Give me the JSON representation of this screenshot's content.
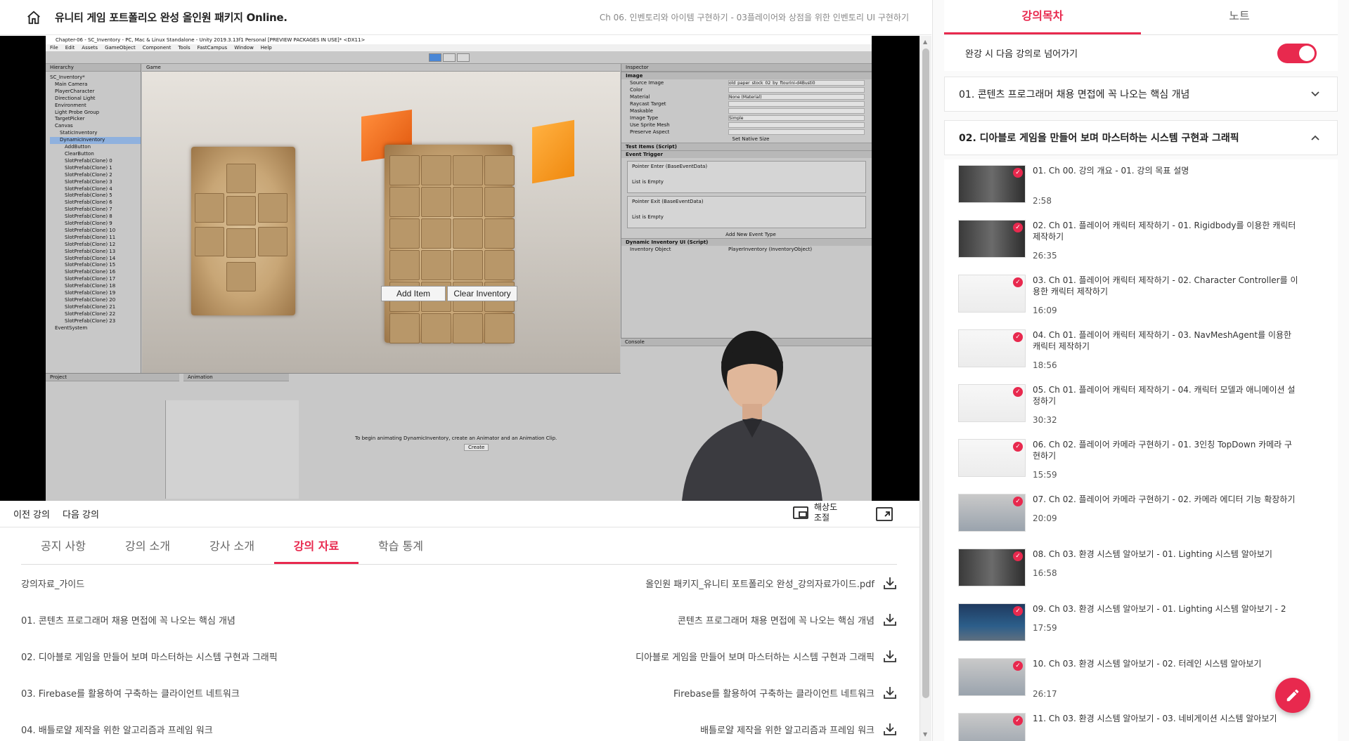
{
  "header": {
    "title": "유니티 게임 포트폴리오 완성 올인원 패키지 Online.",
    "chapter": "Ch 06. 인벤토리와 아이템 구현하기 - 03플레이어와 상점을 위한 인벤토리 UI 구현하기"
  },
  "video": {
    "window_title": "Chapter-06 - SC_Inventory - PC, Mac & Linux Standalone - Unity 2019.3.13f1 Personal [PREVIEW PACKAGES IN USE]* <DX11>",
    "menu": [
      "File",
      "Edit",
      "Assets",
      "GameObject",
      "Component",
      "Tools",
      "FastCampus",
      "Window",
      "Help"
    ],
    "hierarchy_tab": "Hierarchy",
    "hierarchy_items": [
      "SC_Inventory*",
      "Main Camera",
      "PlayerCharacter",
      "Directional Light",
      "Environment",
      "Light Probe Group",
      "TargetPicker",
      "Canvas",
      "StaticInventory",
      "DynamicInventory",
      "AddButton",
      "ClearButton",
      "SlotPrefab(Clone) 0",
      "SlotPrefab(Clone) 1",
      "SlotPrefab(Clone) 2",
      "SlotPrefab(Clone) 3",
      "SlotPrefab(Clone) 4",
      "SlotPrefab(Clone) 5",
      "SlotPrefab(Clone) 6",
      "SlotPrefab(Clone) 7",
      "SlotPrefab(Clone) 8",
      "SlotPrefab(Clone) 9",
      "SlotPrefab(Clone) 10",
      "SlotPrefab(Clone) 11",
      "SlotPrefab(Clone) 12",
      "SlotPrefab(Clone) 13",
      "SlotPrefab(Clone) 14",
      "SlotPrefab(Clone) 15",
      "SlotPrefab(Clone) 16",
      "SlotPrefab(Clone) 17",
      "SlotPrefab(Clone) 18",
      "SlotPrefab(Clone) 19",
      "SlotPrefab(Clone) 20",
      "SlotPrefab(Clone) 21",
      "SlotPrefab(Clone) 22",
      "SlotPrefab(Clone) 23",
      "EventSystem"
    ],
    "game_tab": "Game",
    "game_buttons": {
      "add_item": "Add Item",
      "clear_inventory": "Clear Inventory"
    },
    "inspector_tab": "Inspector",
    "inspector_fields": [
      {
        "k": "Source Image",
        "v": "old_paper_stock_02_by_ftourini-d4Busti0"
      },
      {
        "k": "Color",
        "v": ""
      },
      {
        "k": "Material",
        "v": "None (Material)"
      },
      {
        "k": "Raycast Target",
        "v": ""
      },
      {
        "k": "Maskable",
        "v": ""
      },
      {
        "k": "Image Type",
        "v": "Simple"
      },
      {
        "k": "Use Sprite Mesh",
        "v": ""
      },
      {
        "k": "Preserve Aspect",
        "v": ""
      }
    ],
    "inspector_image_header": "Image",
    "set_native_size": "Set Native Size",
    "test_items_script": "Test Items (Script)",
    "event_trigger": "Event Trigger",
    "pointer_enter": "Pointer Enter (BaseEventData)",
    "pointer_exit": "Pointer Exit (BaseEventData)",
    "list_empty": "List is Empty",
    "add_event": "Add New Event Type",
    "dyn_inv_script": "Dynamic Inventory UI (Script)",
    "inventory_object_label": "Inventory Object",
    "inventory_object_value": "PlayerInventory (InventoryObject)",
    "project_tab": "Project",
    "animation_tab": "Animation",
    "animation_hint": "To begin animating DynamicInventory, create an Animator and an Animation Clip.",
    "create_label": "Create",
    "console_tab": "Console"
  },
  "controls": {
    "prev": "이전 강의",
    "next": "다음 강의",
    "resolution": "해상도 조절"
  },
  "tabs": [
    "공지 사항",
    "강의 소개",
    "강사 소개",
    "강의 자료",
    "학습 통계"
  ],
  "active_tab": "강의 자료",
  "materials": [
    {
      "title": "강의자료_가이드",
      "file": "올인원 패키지_유니티 포트폴리오 완성_강의자료가이드.pdf"
    },
    {
      "title": "01. 콘텐츠 프로그래머 채용 면접에 꼭 나오는 핵심 개념",
      "file": "콘텐츠 프로그래머 채용 면접에 꼭 나오는 핵심 개념"
    },
    {
      "title": "02. 디아블로 게임을 만들어 보며 마스터하는 시스템 구현과 그래픽",
      "file": "디아블로 게임을 만들어 보며 마스터하는 시스템 구현과 그래픽"
    },
    {
      "title": "03. Firebase를 활용하여 구축하는 클라이언트 네트워크",
      "file": "Firebase를 활용하여 구축하는 클라이언트 네트워크"
    },
    {
      "title": "04. 배틀로얄 제작을 위한 알고리즘과 프레임 워크",
      "file": "배틀로얄 제작을 위한 알고리즘과 프레임 워크"
    }
  ],
  "side": {
    "tabs": [
      "강의목차",
      "노트"
    ],
    "autoplay": "완강 시 다음 강의로 넘어가기",
    "autoplay_on": true,
    "sections": [
      {
        "title": "01. 콘텐츠 프로그래머 채용 면접에 꼭 나오는 핵심 개념",
        "open": false
      },
      {
        "title": "02. 디아블로 게임을 만들어 보며 마스터하는 시스템 구현과 그래픽",
        "open": true
      }
    ],
    "lectures": [
      {
        "title": "01. Ch 00. 강의 개요 - 01. 강의 목표 설명",
        "duration": "2:58",
        "thumb": "dark"
      },
      {
        "title": "02. Ch 01. 플레이어 캐릭터 제작하기 - 01. Rigidbody를 이용한 캐릭터 제작하기",
        "duration": "26:35",
        "thumb": "dark"
      },
      {
        "title": "03. Ch 01. 플레이어 캐릭터 제작하기 - 02. Character Controller를 이용한 캐릭터 제작하기",
        "duration": "16:09",
        "thumb": "light"
      },
      {
        "title": "04. Ch 01. 플레이어 캐릭터 제작하기 - 03. NavMeshAgent를 이용한 캐릭터 제작하기",
        "duration": "18:56",
        "thumb": "light"
      },
      {
        "title": "05. Ch 01. 플레이어 캐릭터 제작하기 - 04. 캐릭터 모델과 애니메이션 설정하기",
        "duration": "30:32",
        "thumb": "light"
      },
      {
        "title": "06. Ch 02. 플레이어 카메라 구현하기 - 01. 3인칭 TopDown 카메라 구현하기",
        "duration": "15:59",
        "thumb": "light"
      },
      {
        "title": "07. Ch 02. 플레이어 카메라 구현하기 - 02. 카메라 에디터 기능 확장하기",
        "duration": "20:09",
        "thumb": "editor"
      },
      {
        "title": "08. Ch 03. 환경 시스템 알아보기 - 01. Lighting 시스템 알아보기",
        "duration": "16:58",
        "thumb": "dark"
      },
      {
        "title": "09. Ch 03. 환경 시스템 알아보기 - 01. Lighting 시스템 알아보기 - 2",
        "duration": "17:59",
        "thumb": "probes"
      },
      {
        "title": "10. Ch 03. 환경 시스템 알아보기 - 02. 터레인 시스템 알아보기",
        "duration": "26:17",
        "thumb": "editor"
      },
      {
        "title": "11. Ch 03. 환경 시스템 알아보기 - 03. 네비게이션 시스템 알아보기",
        "duration": "",
        "thumb": "editor"
      }
    ]
  },
  "colors": {
    "accent": "#e8294e"
  }
}
